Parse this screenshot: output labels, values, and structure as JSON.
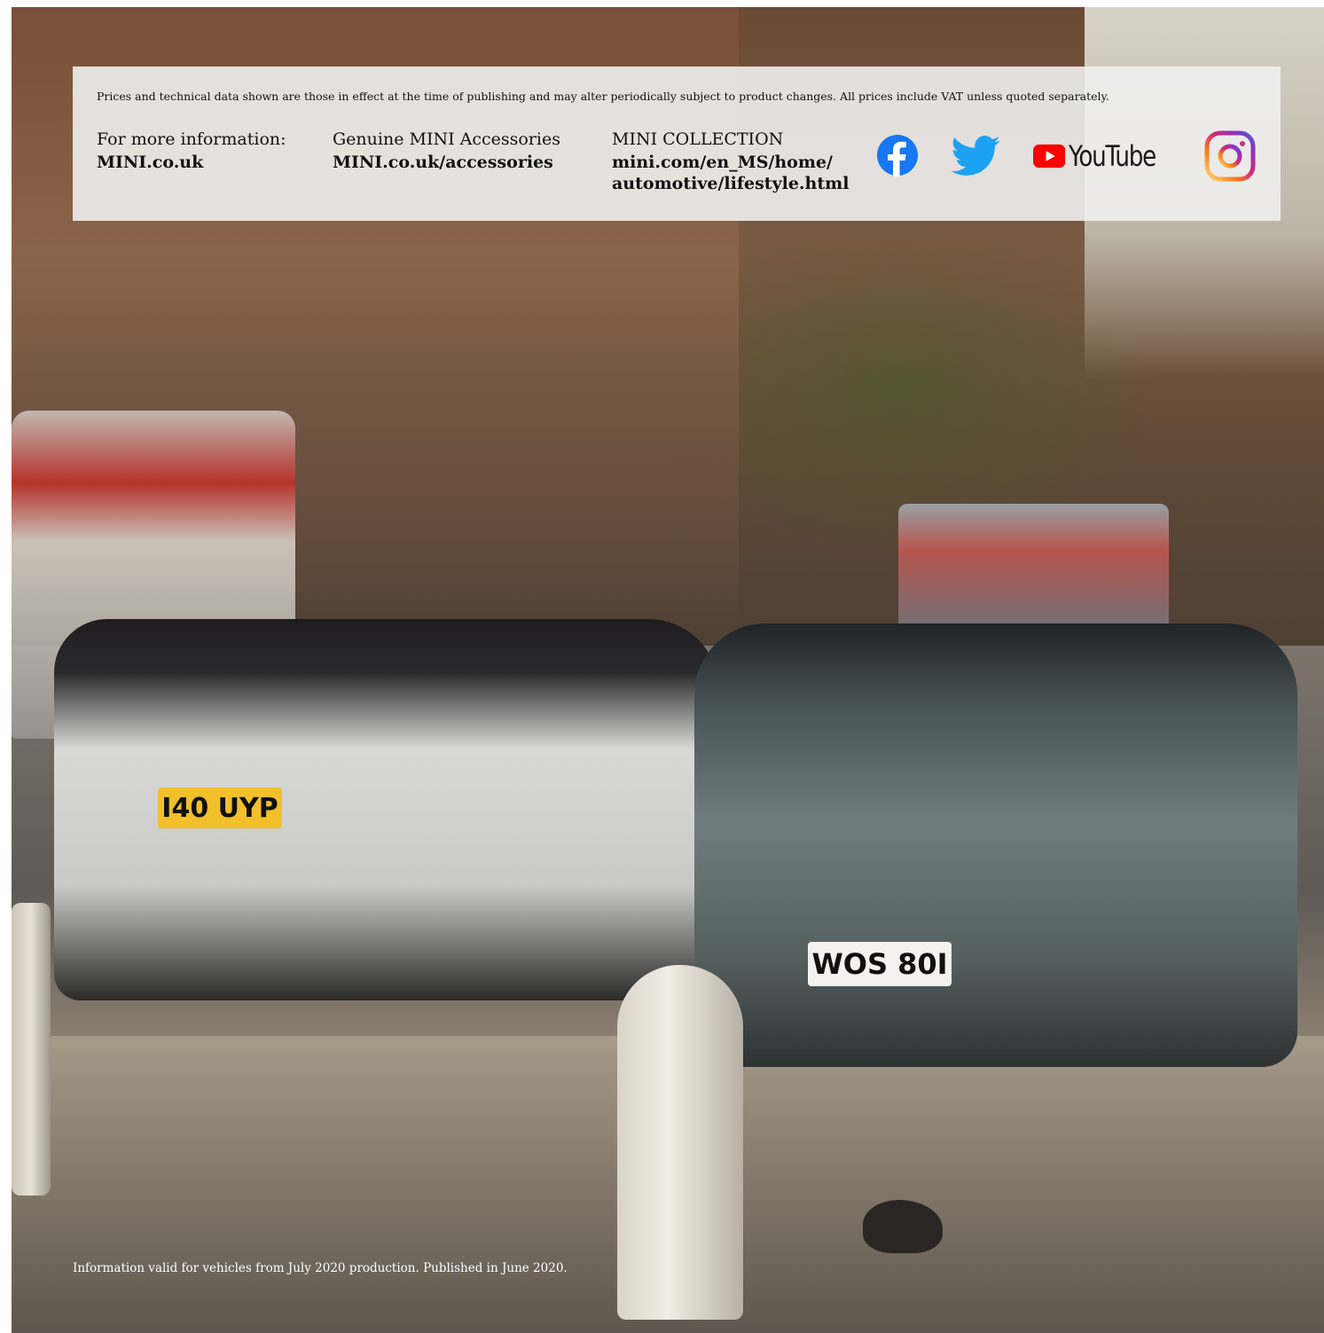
{
  "disclaimer": "Prices and technical data shown are those in effect at the time of publishing and may alter periodically subject to product changes. All prices include VAT unless quoted separately.",
  "info_columns": [
    {
      "label": "For more information:",
      "link": "MINI.co.uk"
    },
    {
      "label": "Genuine MINI Accessories",
      "link": "MINI.co.uk/accessories"
    },
    {
      "label": "MINI COLLECTION",
      "link": "mini.com/en_MS/home/ automotive/lifestyle.html"
    }
  ],
  "social": {
    "facebook_icon": "facebook-icon",
    "twitter_icon": "twitter-icon",
    "youtube_label": "YouTube",
    "instagram_icon": "instagram-icon"
  },
  "photo": {
    "plate_white_car": "I40 UYP",
    "plate_green_car": "WOS 80I"
  },
  "footer": "Information valid for vehicles from July 2020 production. Published in June 2020.",
  "colors": {
    "facebook": "#1877f2",
    "twitter": "#1da1f2",
    "youtube_red": "#ff0000",
    "plate_yellow": "#f1c02b"
  }
}
